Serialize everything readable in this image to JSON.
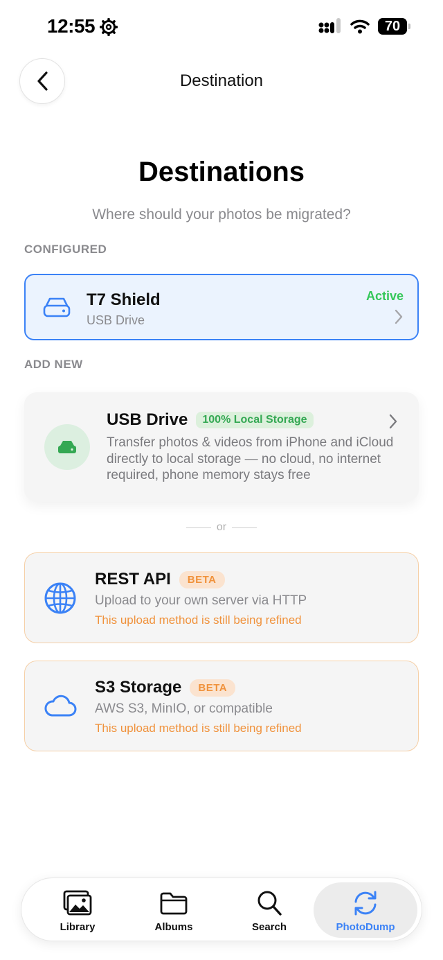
{
  "status_bar": {
    "time": "12:55",
    "battery": "70"
  },
  "nav": {
    "title": "Destination",
    "back_icon": "chevron-left-icon"
  },
  "header": {
    "title": "Destinations",
    "subtitle": "Where should your photos be migrated?"
  },
  "configured": {
    "section_label": "CONFIGURED",
    "items": [
      {
        "name": "T7 Shield",
        "type": "USB Drive",
        "status": "Active",
        "icon": "drive-icon"
      }
    ]
  },
  "add_new": {
    "section_label": "ADD NEW",
    "usb": {
      "title": "USB Drive",
      "badge": "100% Local Storage",
      "description": "Transfer photos & videos from iPhone and iCloud directly to local storage — no cloud, no internet required, phone memory stays free",
      "icon": "drive-icon"
    },
    "divider": "or",
    "beta_items": [
      {
        "title": "REST API",
        "badge": "BETA",
        "subtitle": "Upload to your own server via HTTP",
        "warning": "This upload method is still being refined",
        "icon": "globe-icon"
      },
      {
        "title": "S3 Storage",
        "badge": "BETA",
        "subtitle": "AWS S3, MinIO, or compatible",
        "warning": "This upload method is still being refined",
        "icon": "cloud-icon"
      }
    ]
  },
  "tab_bar": {
    "tabs": [
      {
        "label": "Library",
        "icon": "photos-icon",
        "active": false
      },
      {
        "label": "Albums",
        "icon": "folder-icon",
        "active": false
      },
      {
        "label": "Search",
        "icon": "search-icon",
        "active": false
      },
      {
        "label": "PhotoDump",
        "icon": "sync-icon",
        "active": true
      }
    ]
  },
  "colors": {
    "accent": "#3b82f6",
    "active_green": "#34c759",
    "beta_orange": "#f0923c"
  }
}
